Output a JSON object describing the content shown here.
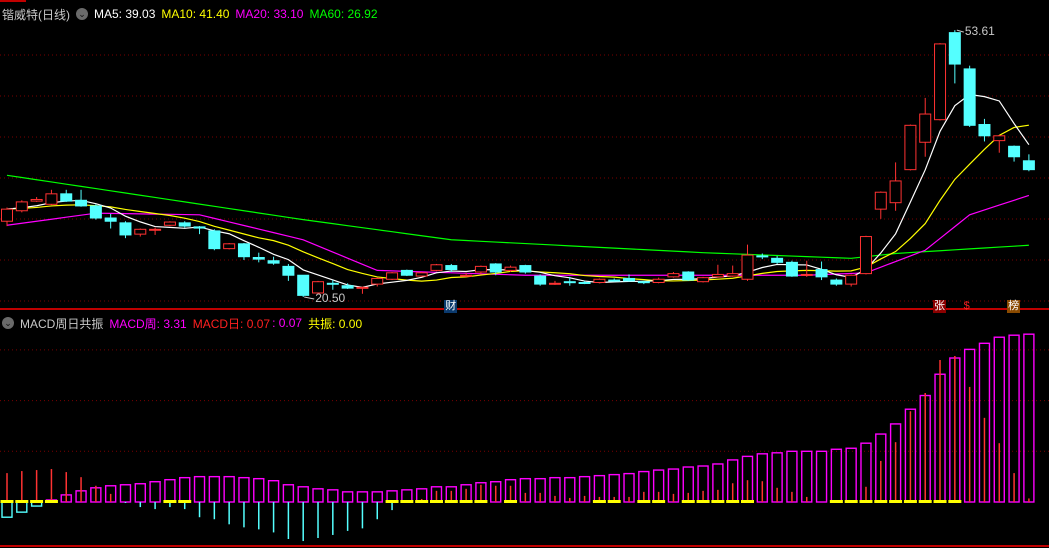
{
  "main_legend": {
    "title": "锴威特(日线)",
    "ma5": "MA5: 39.03",
    "ma10": "MA10: 41.40",
    "ma20": "MA20: 33.10",
    "ma60": "MA60: 26.92"
  },
  "macd_legend": {
    "title": "MACD周日共振",
    "weekly": "MACD周: 3.31",
    "daily": "MACD日: 0.07",
    "daily2": ": 0.07",
    "resonance": "共振: 0.00"
  },
  "colors": {
    "up": "#ff3232",
    "down": "#54ffff",
    "ma5": "#ffffff",
    "ma10": "#ffff00",
    "ma20": "#ff00ff",
    "ma60": "#00ff00",
    "grid": "#7a0000",
    "separator": "#c00000",
    "weekly": "#ff00ff",
    "resonance": "#ffff00"
  },
  "price_labels": {
    "high": "53.61",
    "low": "20.50"
  },
  "event_markers": [
    {
      "text": "财",
      "index": 30,
      "bg": "#0b3a6e",
      "fg": "#ffffff"
    },
    {
      "text": "张",
      "index": 63,
      "bg": "#8b0000",
      "fg": "#ffffff"
    },
    {
      "text": "$",
      "index": 65,
      "bg": "transparent",
      "fg": "#ff2020"
    },
    {
      "text": "榜",
      "index": 68,
      "bg": "#8a4a00",
      "fg": "#ffffff"
    }
  ],
  "chart_data": [
    {
      "type": "candlestick",
      "title": "锴威特(日线)",
      "price_range": [
        20.5,
        53.61
      ],
      "high_index": 64,
      "low_index": 20,
      "candles_ochl_note": "[open, close, high, low]",
      "candles": [
        [
          29.9,
          31.4,
          31.6,
          29.3
        ],
        [
          31.2,
          32.3,
          32.5,
          31.0
        ],
        [
          32.4,
          32.6,
          32.9,
          32.3
        ],
        [
          32.0,
          33.3,
          33.8,
          31.9
        ],
        [
          33.3,
          32.4,
          33.8,
          32.3
        ],
        [
          32.5,
          31.8,
          33.8,
          31.7
        ],
        [
          31.8,
          30.3,
          32.0,
          30.1
        ],
        [
          30.3,
          29.9,
          30.8,
          29.0
        ],
        [
          29.7,
          28.2,
          29.9,
          27.8
        ],
        [
          28.3,
          28.9,
          29.0,
          28.0
        ],
        [
          28.8,
          28.9,
          29.1,
          28.2
        ],
        [
          29.4,
          29.8,
          29.9,
          29.3
        ],
        [
          29.7,
          29.3,
          29.9,
          29.1
        ],
        [
          29.2,
          29.05,
          29.3,
          28.3
        ],
        [
          28.7,
          26.5,
          28.9,
          26.3
        ],
        [
          26.5,
          27.1,
          27.2,
          26.4
        ],
        [
          27.1,
          25.5,
          27.2,
          25.1
        ],
        [
          25.4,
          25.2,
          26.0,
          24.8
        ],
        [
          25.0,
          24.7,
          25.5,
          24.5
        ],
        [
          24.3,
          23.2,
          24.6,
          22.5
        ],
        [
          23.2,
          20.7,
          23.2,
          20.5
        ],
        [
          21.0,
          22.4,
          22.5,
          20.9
        ],
        [
          22.2,
          22.1,
          22.6,
          21.4
        ],
        [
          21.9,
          21.6,
          22.2,
          21.5
        ],
        [
          21.6,
          21.7,
          21.8,
          20.9
        ],
        [
          22.1,
          22.8,
          22.9,
          21.8
        ],
        [
          22.7,
          23.5,
          23.6,
          22.6
        ],
        [
          23.8,
          23.2,
          23.9,
          23.1
        ],
        [
          23.1,
          23.5,
          23.6,
          23.0
        ],
        [
          23.8,
          24.5,
          24.6,
          23.7
        ],
        [
          24.4,
          23.9,
          24.6,
          23.6
        ],
        [
          23.1,
          23.2,
          23.5,
          23.0
        ],
        [
          23.6,
          24.3,
          24.4,
          23.3
        ],
        [
          24.6,
          23.6,
          24.7,
          23.2
        ],
        [
          23.8,
          24.2,
          24.4,
          23.6
        ],
        [
          24.4,
          23.6,
          24.5,
          23.4
        ],
        [
          23.1,
          22.1,
          23.3,
          21.9
        ],
        [
          22.1,
          22.2,
          22.5,
          22.0
        ],
        [
          22.4,
          22.3,
          23.0,
          21.9
        ],
        [
          22.3,
          22.2,
          22.5,
          22.1
        ],
        [
          22.3,
          22.7,
          22.8,
          22.2
        ],
        [
          22.6,
          22.5,
          22.8,
          22.4
        ],
        [
          22.8,
          22.5,
          23.3,
          22.4
        ],
        [
          22.4,
          22.3,
          22.5,
          22.1
        ],
        [
          22.3,
          22.7,
          22.9,
          22.2
        ],
        [
          23.0,
          23.4,
          23.6,
          22.9
        ],
        [
          23.6,
          22.6,
          23.7,
          22.5
        ],
        [
          22.4,
          22.9,
          23.0,
          22.3
        ],
        [
          23.0,
          23.3,
          24.5,
          22.9
        ],
        [
          23.1,
          23.4,
          24.4,
          23.0
        ],
        [
          22.7,
          25.7,
          27.0,
          22.5
        ],
        [
          25.6,
          25.5,
          25.9,
          25.2
        ],
        [
          25.3,
          24.8,
          25.6,
          24.6
        ],
        [
          24.8,
          23.1,
          25.0,
          23.0
        ],
        [
          23.2,
          23.3,
          25.0,
          23.0
        ],
        [
          23.9,
          23.0,
          24.9,
          22.6
        ],
        [
          22.6,
          22.1,
          22.8,
          21.9
        ],
        [
          22.1,
          23.2,
          23.3,
          21.8
        ],
        [
          23.4,
          28.0,
          28.1,
          23.3
        ],
        [
          31.4,
          33.5,
          33.6,
          30.2
        ],
        [
          32.2,
          34.9,
          37.2,
          31.2
        ],
        [
          36.3,
          41.8,
          41.9,
          36.2
        ],
        [
          39.7,
          43.2,
          45.2,
          37.9
        ],
        [
          42.5,
          51.9,
          52.0,
          42.4
        ],
        [
          53.3,
          49.4,
          53.61,
          47.0
        ],
        [
          48.8,
          41.8,
          49.2,
          41.6
        ],
        [
          41.9,
          40.5,
          42.6,
          39.8
        ],
        [
          39.9,
          40.5,
          40.6,
          38.4
        ],
        [
          39.2,
          37.9,
          39.3,
          37.3
        ],
        [
          37.4,
          36.3,
          38.2,
          36.1
        ]
      ],
      "ma20_points": [
        [
          0,
          29.4
        ],
        [
          6,
          30.9
        ],
        [
          13,
          30.7
        ],
        [
          20,
          27.6
        ],
        [
          25,
          23.8
        ],
        [
          35,
          23.2
        ],
        [
          54,
          23.2
        ],
        [
          58,
          23.5
        ],
        [
          62,
          26.3
        ],
        [
          65,
          30.7
        ],
        [
          69,
          33.1
        ]
      ],
      "ma60_points": [
        [
          0,
          35.6
        ],
        [
          20,
          30.1
        ],
        [
          30,
          27.6
        ],
        [
          47,
          26.0
        ],
        [
          57,
          25.3
        ],
        [
          60,
          25.9
        ],
        [
          69,
          26.92
        ]
      ]
    },
    {
      "type": "bar",
      "title": "MACD周日共振",
      "y_range": [
        -1,
        3.35
      ],
      "grid_values": [
        1,
        2,
        3
      ],
      "weekly": [
        -0.3,
        -0.2,
        -0.08,
        0.04,
        0.14,
        0.22,
        0.28,
        0.32,
        0.34,
        0.36,
        0.4,
        0.44,
        0.48,
        0.5,
        0.5,
        0.5,
        0.48,
        0.46,
        0.42,
        0.34,
        0.3,
        0.26,
        0.24,
        0.2,
        0.2,
        0.2,
        0.22,
        0.24,
        0.26,
        0.3,
        0.3,
        0.34,
        0.38,
        0.4,
        0.44,
        0.46,
        0.46,
        0.48,
        0.48,
        0.5,
        0.52,
        0.54,
        0.56,
        0.6,
        0.63,
        0.65,
        0.69,
        0.71,
        0.75,
        0.83,
        0.9,
        0.95,
        0.97,
        1.0,
        1.0,
        1.0,
        1.04,
        1.06,
        1.16,
        1.34,
        1.54,
        1.83,
        2.1,
        2.52,
        2.84,
        3.01,
        3.13,
        3.25,
        3.29,
        3.31
      ],
      "daily": [
        0.57,
        0.61,
        0.63,
        0.65,
        0.59,
        0.49,
        0.32,
        0.16,
        -0.02,
        -0.1,
        -0.14,
        -0.1,
        -0.14,
        -0.3,
        -0.34,
        -0.44,
        -0.5,
        -0.54,
        -0.6,
        -0.73,
        -0.77,
        -0.71,
        -0.65,
        -0.57,
        -0.52,
        -0.34,
        -0.16,
        0,
        0.06,
        0.22,
        0.22,
        0.26,
        0.34,
        0.32,
        0.32,
        0.18,
        0.18,
        0.12,
        0.08,
        0.12,
        0.1,
        0.1,
        0.1,
        0.2,
        0.2,
        0.16,
        0.18,
        0.22,
        0.24,
        0.37,
        0.43,
        0.41,
        0.28,
        0.2,
        0.1,
        0,
        0,
        0,
        0.3,
        0.81,
        1.18,
        1.79,
        2.15,
        2.8,
        2.88,
        2.27,
        1.66,
        1.16,
        0.57,
        0.07
      ],
      "resonance_indices": [
        0,
        1,
        2,
        3,
        11,
        12,
        26,
        27,
        28,
        29,
        30,
        31,
        32,
        34,
        40,
        41,
        43,
        44,
        46,
        47,
        48,
        49,
        50,
        56,
        57,
        58,
        59,
        60,
        61,
        62,
        63,
        64
      ]
    }
  ]
}
